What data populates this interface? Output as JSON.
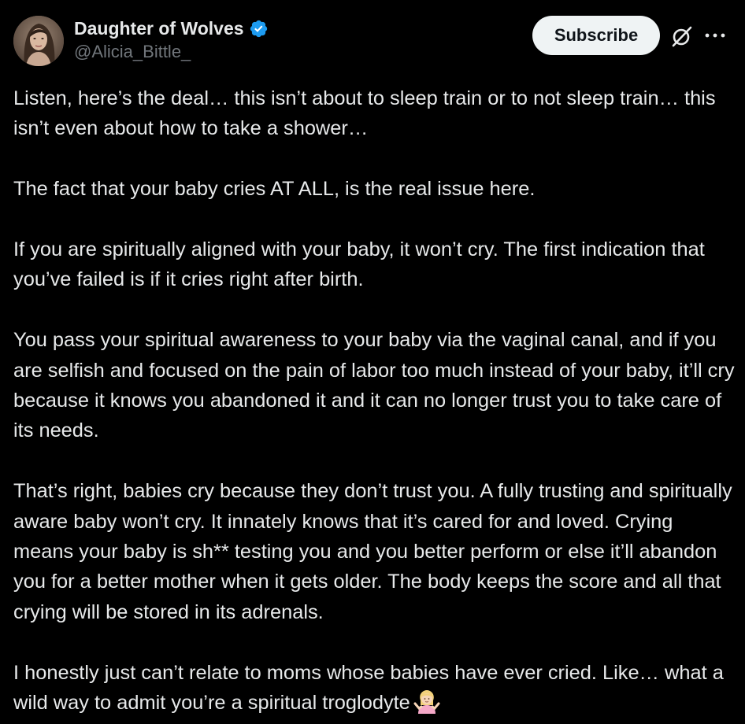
{
  "author": {
    "display_name": "Daughter of Wolves",
    "handle": "@Alicia_Bittle_",
    "verified": true,
    "verified_color": "#1d9bf0"
  },
  "actions": {
    "subscribe_label": "Subscribe",
    "grok_icon": "grok-icon",
    "more_icon": "more-horizontal-icon"
  },
  "tweet": {
    "paragraphs": [
      "Listen, here’s the deal… this isn’t about to sleep train or to not sleep train… this isn’t even about how to take a shower…",
      "The fact that your baby cries AT ALL, is the real issue here.",
      "If you are spiritually aligned with your baby, it won’t cry. The first indication that you’ve failed is if it cries right after birth.",
      "You pass your spiritual awareness to your baby via the vaginal canal, and if you are selfish and focused on the pain of labor too much instead of your baby, it’ll cry because it knows you abandoned it and it can no longer trust you to take care of its needs.",
      "That’s right, babies cry because they don’t trust you. A fully trusting and spiritually aware baby won’t cry. It innately knows that it’s cared for and loved. Crying means your baby is sh** testing you and you better perform or else it’ll abandon you for a better mother when it gets older. The body keeps the score and all that crying will be stored in its adrenals.",
      "I honestly just can’t relate to moms whose babies have ever cried. Like… what a wild way to admit you’re a spiritual troglodyte"
    ],
    "trailing_emoji": "woman-shrugging-emoji"
  },
  "colors": {
    "background": "#000000",
    "text": "#e7e9ea",
    "secondary_text": "#71767b",
    "button_bg": "#eff3f4"
  }
}
